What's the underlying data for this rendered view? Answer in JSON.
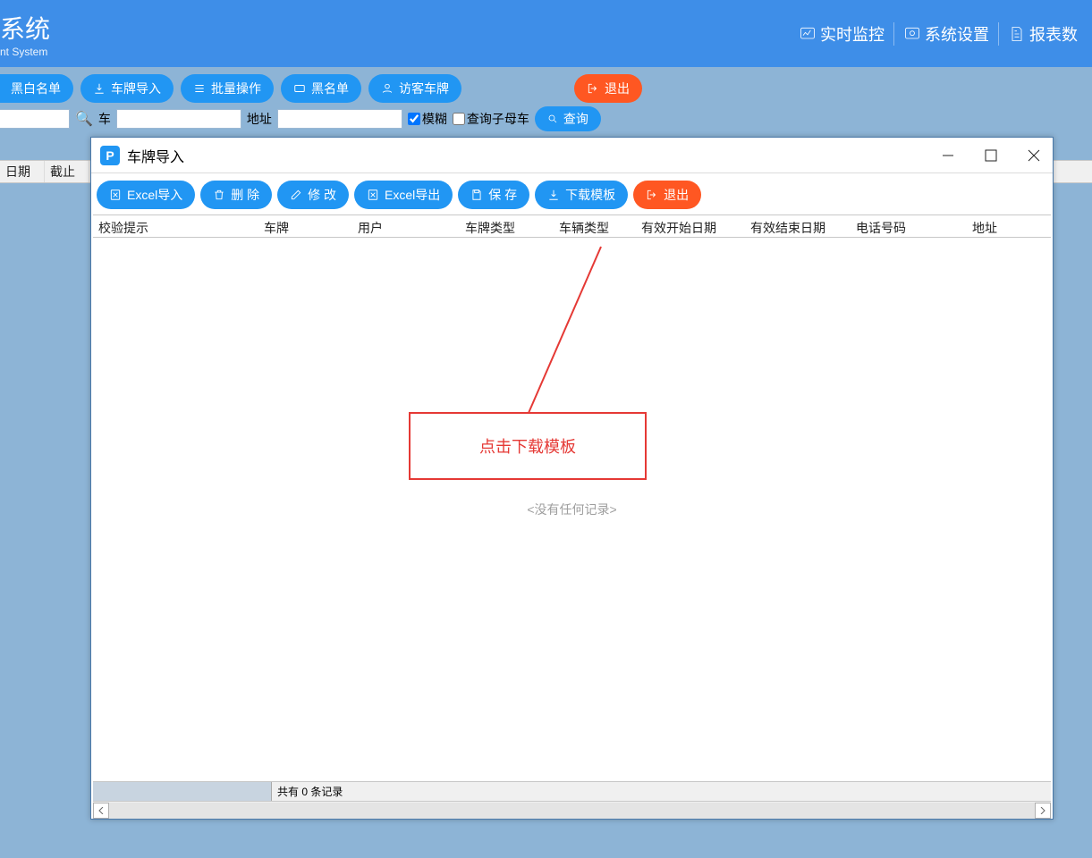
{
  "header": {
    "title_suffix": "系统",
    "subtitle_suffix": "nt System",
    "nav": {
      "monitor": "实时监控",
      "settings": "系统设置",
      "reports": "报表数"
    }
  },
  "top_pills": {
    "blackwhite": "黑白名单",
    "plate_import": "车牌导入",
    "batch": "批量操作",
    "blacklist": "黑名单",
    "visitor": "访客车牌",
    "exit": "退出"
  },
  "search": {
    "owner_label_partial": "车",
    "address_label": "地址",
    "fuzzy_label": "模糊",
    "query_parent_child": "查询子母车",
    "query_btn": "查询"
  },
  "back_grid": {
    "col_date": "日期",
    "col_end": "截止"
  },
  "dialog": {
    "title": "车牌导入",
    "toolbar": {
      "excel_import": "Excel导入",
      "delete": "删 除",
      "modify": "修 改",
      "excel_export": "Excel导出",
      "save": "保 存",
      "download_template": "下载模板",
      "exit": "退出"
    },
    "columns": {
      "check_tip": "校验提示",
      "plate": "车牌",
      "user": "用户",
      "plate_type": "车牌类型",
      "vehicle_type": "车辆类型",
      "start_date": "有效开始日期",
      "end_date": "有效结束日期",
      "phone": "电话号码",
      "address": "地址"
    },
    "empty_text": "<没有任何记录>",
    "status_text": "共有 0 条记录",
    "annotation": "点击下载模板"
  }
}
